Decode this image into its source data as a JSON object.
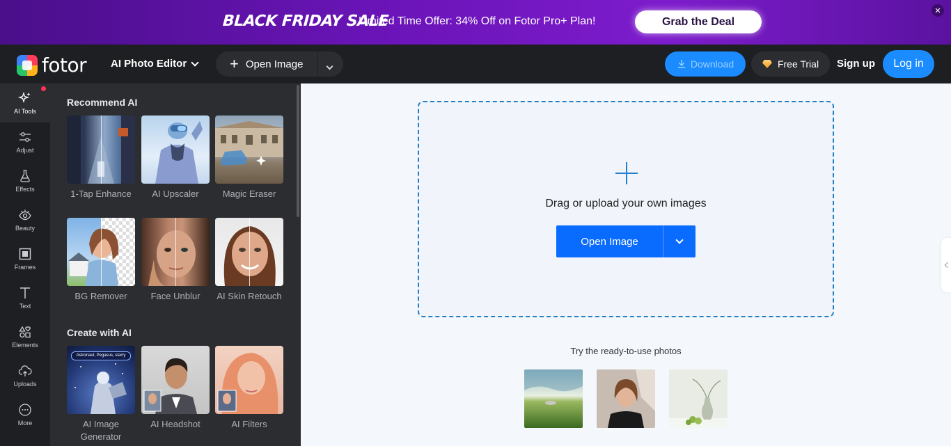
{
  "promo": {
    "sale_title": "BLACK FRIDAY SALE",
    "offer_text": "Limited Time Offer: 34% Off on Fotor Pro+ Plan!",
    "cta_label": "Grab the Deal",
    "close_glyph": "✕"
  },
  "header": {
    "logo_text": "fotor",
    "editor_label": "AI Photo Editor",
    "open_image_label": "Open Image",
    "download_label": "Download",
    "free_trial_label": "Free Trial",
    "signup_label": "Sign up",
    "login_label": "Log in"
  },
  "rail": {
    "items": [
      {
        "label": "AI Tools",
        "icon": "sparkle-icon"
      },
      {
        "label": "Adjust",
        "icon": "sliders-icon"
      },
      {
        "label": "Effects",
        "icon": "flask-icon"
      },
      {
        "label": "Beauty",
        "icon": "eye-icon"
      },
      {
        "label": "Frames",
        "icon": "frame-icon"
      },
      {
        "label": "Text",
        "icon": "text-icon"
      },
      {
        "label": "Elements",
        "icon": "shapes-icon"
      },
      {
        "label": "Uploads",
        "icon": "upload-cloud-icon"
      },
      {
        "label": "More",
        "icon": "more-icon"
      }
    ]
  },
  "panel": {
    "recommend_title": "Recommend AI",
    "recommend": [
      {
        "label": "1-Tap Enhance"
      },
      {
        "label": "AI Upscaler"
      },
      {
        "label": "Magic Eraser"
      },
      {
        "label": "BG Remover"
      },
      {
        "label": "Face Unblur"
      },
      {
        "label": "AI Skin Retouch"
      }
    ],
    "create_title": "Create with AI",
    "create": [
      {
        "label": "AI Image Generator",
        "caption": "Astronaut, Pegasus, starry"
      },
      {
        "label": "AI Headshot"
      },
      {
        "label": "AI Filters"
      }
    ]
  },
  "canvas": {
    "drop_text": "Drag or upload your own images",
    "open_image_label": "Open Image",
    "try_text": "Try the ready-to-use photos"
  },
  "colors": {
    "accent": "#0a6bff",
    "panel_bg": "#2c2d31",
    "topbar_bg": "#1e1f22",
    "promo_purple": "#6a14b8"
  }
}
